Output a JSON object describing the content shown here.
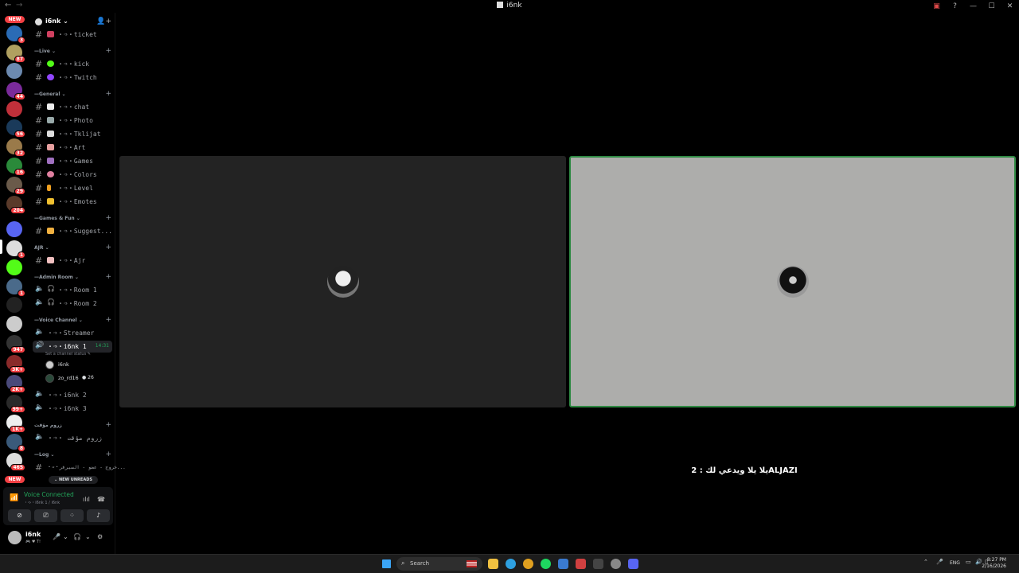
{
  "window": {
    "title": "i6nk",
    "back_glyph": "←",
    "forward_glyph": "→"
  },
  "server_rail": {
    "top_badge": "NEW",
    "bottom_badge": "NEW",
    "servers": [
      {
        "name": "server-1",
        "badge": "3",
        "color": "#2a6bb5"
      },
      {
        "name": "server-2",
        "badge": "87",
        "color": "#b0a060"
      },
      {
        "name": "server-3",
        "badge": "",
        "color": "#6c8ab0"
      },
      {
        "name": "server-4",
        "badge": "44",
        "color": "#7a2a9a"
      },
      {
        "name": "server-5",
        "badge": "",
        "color": "#c0303a"
      },
      {
        "name": "server-6",
        "badge": "56",
        "color": "#1a3a5a"
      },
      {
        "name": "server-7",
        "badge": "32",
        "color": "#9a7a4a"
      },
      {
        "name": "server-8",
        "badge": "16",
        "color": "#2a8a3a"
      },
      {
        "name": "server-9",
        "badge": "29",
        "color": "#6a5a4a"
      },
      {
        "name": "server-10",
        "badge": "204",
        "color": "#5a3a2a"
      },
      {
        "name": "server-11",
        "badge": "",
        "color": "#5865f2"
      },
      {
        "name": "server-12",
        "badge": "1",
        "color": "#dddddd"
      },
      {
        "name": "server-13",
        "badge": "",
        "color": "#53fc18"
      },
      {
        "name": "server-14",
        "badge": "1",
        "color": "#4a6a8a"
      },
      {
        "name": "server-15",
        "badge": "",
        "color": "#222222"
      },
      {
        "name": "server-16",
        "badge": "",
        "color": "#cccccc"
      },
      {
        "name": "server-17",
        "badge": "947",
        "color": "#333333"
      },
      {
        "name": "server-18",
        "badge": "3K+",
        "color": "#8a2a2a"
      },
      {
        "name": "server-19",
        "badge": "2K+",
        "color": "#4a4a7a"
      },
      {
        "name": "server-20",
        "badge": "99+",
        "color": "#2a2a2a"
      },
      {
        "name": "server-21",
        "badge": "1K+",
        "color": "#eeeeee"
      },
      {
        "name": "server-22",
        "badge": "8",
        "color": "#3a5a7a"
      },
      {
        "name": "server-23",
        "badge": "465",
        "color": "#dddddd"
      }
    ]
  },
  "guild": {
    "name": "i6nk",
    "chevron": "⌄"
  },
  "categories": {
    "live": "Live",
    "general": "General",
    "games_fun": "Games & Fun",
    "ajr": "AJR",
    "admin_room": "Admin Room",
    "voice_channel": "Voice Channel",
    "arabic_temp": "زروم مؤقت",
    "log": "Log"
  },
  "channels": {
    "ticket": "・➩・ticket",
    "kick": "・➩・kick",
    "twitch": "・➩・Twitch",
    "chat": "・➩・chat",
    "photo": "・➩・Photo",
    "tklijat": "・➩・Tklijat",
    "art": "・➩・Art",
    "games": "・➩・Games",
    "colors": "・➩・Colors",
    "level": "・➩・Level",
    "emotes": "・➩・Emotes",
    "suggest": "・➩・Suggest...",
    "ajr": "・➩・Ajr",
    "room1": "・➩・Room 1",
    "room2": "・➩・Room 2",
    "streamer": "・➩・Streamer",
    "i6nk1": "・➩・i6nk 1",
    "i6nk1_time": "14:31",
    "i6nk1_status": "Set a channel status",
    "i6nk2": "・➩・i6nk 2",
    "i6nk3": "・➩・i6nk 3",
    "temp_room": "・➩・ زروم مؤقت",
    "log_channel": "・➩・خروج - عضو - السيرفر..."
  },
  "voice_users": [
    {
      "name": "i6nk",
      "level": ""
    },
    {
      "name": "zo_rd16",
      "level": "26"
    }
  ],
  "new_unreads": "NEW UNREADS",
  "voice_panel": {
    "title": "Voice Connected",
    "subtitle": "・➩・i6nk 1 / i6nk"
  },
  "user_bar": {
    "username": "i6nk",
    "status": "🎮 ♥ T!"
  },
  "stage": {
    "caption": "يلا يلا ويدعي لك : 2ALJAZI"
  },
  "taskbar": {
    "search_placeholder": "Search",
    "lang": "ENG",
    "time": "8:27 PM",
    "date": "2/16/2026"
  }
}
